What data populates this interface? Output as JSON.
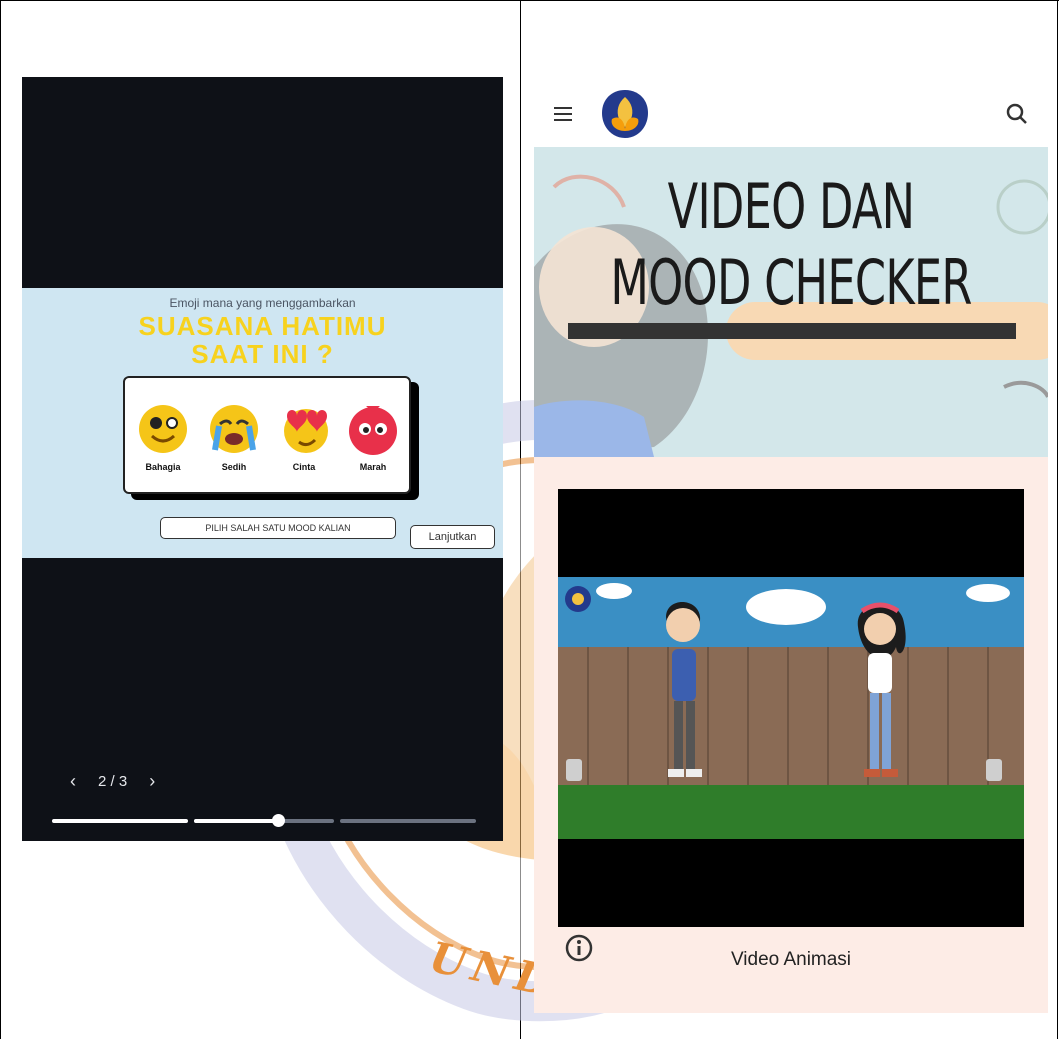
{
  "left_panel": {
    "slide": {
      "subtitle": "Emoji mana yang menggambarkan",
      "title_line1": "SUASANA HATIMU",
      "title_line2": "SAAT INI ?",
      "emojis": [
        {
          "label": "Bahagia",
          "icon": "happy-face-icon",
          "color": "#f5c518"
        },
        {
          "label": "Sedih",
          "icon": "crying-face-icon",
          "color": "#f5c518"
        },
        {
          "label": "Cinta",
          "icon": "love-face-icon",
          "color": "#f5c518"
        },
        {
          "label": "Marah",
          "icon": "angry-face-icon",
          "color": "#e8304a"
        }
      ],
      "mood_prompt": "PILIH SALAH SATU MOOD KALIAN",
      "next_label": "Lanjutkan"
    },
    "pager": {
      "prev_icon": "chevron-left-icon",
      "page": "2 / 3",
      "next_icon": "chevron-right-icon"
    },
    "progress": {
      "segments": 3,
      "current": 2,
      "current_fraction": 0.6
    }
  },
  "right_panel": {
    "header": {
      "menu_icon": "hamburger-menu-icon",
      "logo_icon": "university-logo-icon",
      "search_icon": "search-icon"
    },
    "hero": {
      "title_line1": "VIDEO DAN",
      "title_line2": "MOOD CHECKER"
    },
    "video": {
      "caption": "Video Animasi",
      "info_icon": "info-icon"
    }
  },
  "watermark": {
    "text": "UNDIK"
  },
  "colors": {
    "slide_bg": "#cfe6f2",
    "title_yellow": "#f7d21e",
    "card_bg": "#fdece6",
    "hero_bg": "#d3e7ea",
    "screen_dark": "#0e1117"
  }
}
